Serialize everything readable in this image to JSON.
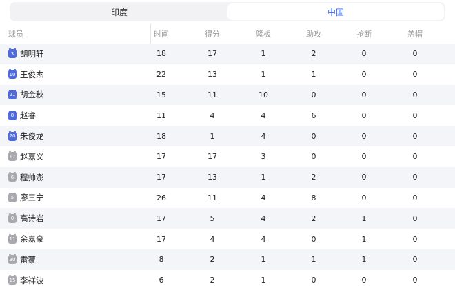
{
  "tabs": [
    {
      "label": "印度",
      "active": false
    },
    {
      "label": "中国",
      "active": true
    }
  ],
  "headers": {
    "player": "球员",
    "minutes": "时间",
    "points": "得分",
    "rebounds": "篮板",
    "assists": "助攻",
    "steals": "抢断",
    "blocks": "盖帽"
  },
  "colors": {
    "accent": "#3d6bff",
    "starter_badge": "#4f6bdb",
    "bench_badge": "#a8a8ae"
  },
  "players": [
    {
      "number": "3",
      "name": "胡明轩",
      "starter": true,
      "minutes": "18",
      "points": "17",
      "rebounds": "1",
      "assists": "2",
      "steals": "0",
      "blocks": "0"
    },
    {
      "number": "10",
      "name": "王俊杰",
      "starter": true,
      "minutes": "22",
      "points": "13",
      "rebounds": "1",
      "assists": "1",
      "steals": "0",
      "blocks": "0"
    },
    {
      "number": "21",
      "name": "胡金秋",
      "starter": true,
      "minutes": "15",
      "points": "11",
      "rebounds": "10",
      "assists": "0",
      "steals": "0",
      "blocks": "0"
    },
    {
      "number": "8",
      "name": "赵睿",
      "starter": true,
      "minutes": "11",
      "points": "4",
      "rebounds": "4",
      "assists": "6",
      "steals": "0",
      "blocks": "0"
    },
    {
      "number": "20",
      "name": "朱俊龙",
      "starter": true,
      "minutes": "18",
      "points": "1",
      "rebounds": "4",
      "assists": "0",
      "steals": "0",
      "blocks": "0"
    },
    {
      "number": "17",
      "name": "赵嘉义",
      "starter": false,
      "minutes": "17",
      "points": "17",
      "rebounds": "3",
      "assists": "0",
      "steals": "0",
      "blocks": "0"
    },
    {
      "number": "6",
      "name": "程帅澎",
      "starter": false,
      "minutes": "17",
      "points": "13",
      "rebounds": "1",
      "assists": "2",
      "steals": "0",
      "blocks": "0"
    },
    {
      "number": "5",
      "name": "廖三宁",
      "starter": false,
      "minutes": "26",
      "points": "11",
      "rebounds": "4",
      "assists": "8",
      "steals": "0",
      "blocks": "0"
    },
    {
      "number": "0",
      "name": "高诗岩",
      "starter": false,
      "minutes": "17",
      "points": "5",
      "rebounds": "4",
      "assists": "2",
      "steals": "1",
      "blocks": "0"
    },
    {
      "number": "11",
      "name": "余嘉豪",
      "starter": false,
      "minutes": "17",
      "points": "4",
      "rebounds": "4",
      "assists": "0",
      "steals": "1",
      "blocks": "0"
    },
    {
      "number": "30",
      "name": "雷蒙",
      "starter": false,
      "minutes": "8",
      "points": "2",
      "rebounds": "1",
      "assists": "1",
      "steals": "1",
      "blocks": "0"
    },
    {
      "number": "15",
      "name": "李祥波",
      "starter": false,
      "minutes": "6",
      "points": "2",
      "rebounds": "1",
      "assists": "0",
      "steals": "0",
      "blocks": "0"
    }
  ]
}
